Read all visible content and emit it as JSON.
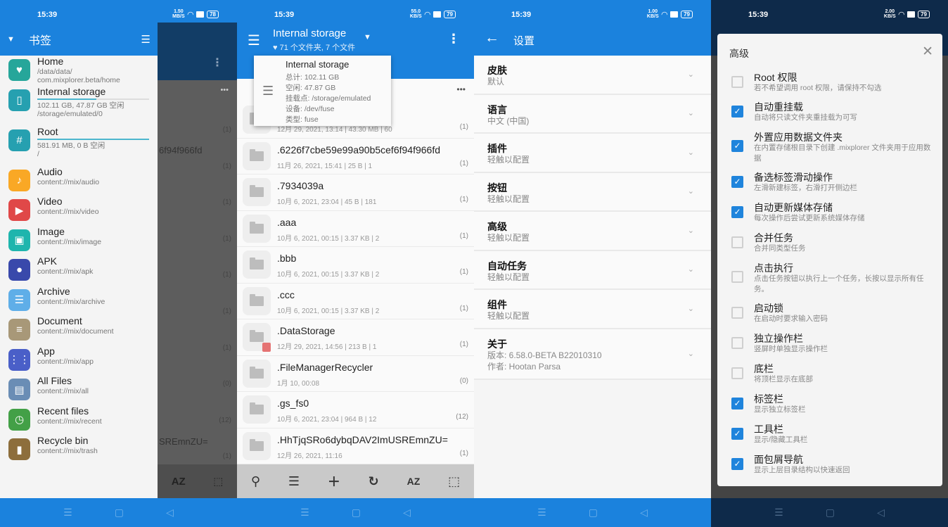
{
  "status_bars": [
    {
      "time": "15:39",
      "net_speed": "1.50",
      "net_unit": "MB/S",
      "battery": "78"
    },
    {
      "time": "15:39",
      "net_speed": "55.0",
      "net_unit": "KB/S",
      "battery": "79"
    },
    {
      "time": "15:39",
      "net_speed": "1.00",
      "net_unit": "KB/S",
      "battery": "79"
    },
    {
      "time": "15:39",
      "net_speed": "2.00",
      "net_unit": "KB/S",
      "battery": "79"
    }
  ],
  "colors": {
    "primary": "#1b82dd",
    "checkbox": "#1f84dc"
  },
  "drawer": {
    "title": "书签",
    "items": [
      {
        "name": "Home",
        "sub": "/data/data/",
        "sub2": "com.mixplorer.beta/home",
        "icon": "heart-icon",
        "color": "#26a69a"
      },
      {
        "name": "Internal storage",
        "sub": "102.11 GB, 47.87 GB 空闲",
        "sub2": "/storage/emulated/0",
        "icon": "phone-icon",
        "color": "#26a0b0",
        "usage": 0.53
      },
      {
        "name": "Root",
        "sub": "581.91 MB, 0 B 空闲",
        "sub2": "/",
        "icon": "hash-icon",
        "color": "#26a0b0",
        "usage": 1.0
      },
      {
        "name": "Audio",
        "sub": "content://mix/audio",
        "icon": "music-icon",
        "color": "#f9a825"
      },
      {
        "name": "Video",
        "sub": "content://mix/video",
        "icon": "play-icon",
        "color": "#e04848"
      },
      {
        "name": "Image",
        "sub": "content://mix/image",
        "icon": "image-icon",
        "color": "#1eb5ad"
      },
      {
        "name": "APK",
        "sub": "content://mix/apk",
        "icon": "android-icon",
        "color": "#3949ab"
      },
      {
        "name": "Archive",
        "sub": "content://mix/archive",
        "icon": "archive-icon",
        "color": "#5faee8"
      },
      {
        "name": "Document",
        "sub": "content://mix/document",
        "icon": "document-icon",
        "color": "#a89878"
      },
      {
        "name": "App",
        "sub": "content://mix/app",
        "icon": "grid-icon",
        "color": "#4a5fc8"
      },
      {
        "name": "All Files",
        "sub": "content://mix/all",
        "icon": "file-icon",
        "color": "#6a8db5"
      },
      {
        "name": "Recent files",
        "sub": "content://mix/recent",
        "icon": "clock-icon",
        "color": "#43a047"
      },
      {
        "name": "Recycle bin",
        "sub": "content://mix/trash",
        "icon": "trash-icon",
        "color": "#8d6e3c"
      }
    ],
    "behind_text": [
      "6f94f966fd",
      "SREmnZU="
    ],
    "behind_counts": [
      "(1)",
      "(1)",
      "(1)",
      "(1)",
      "(1)",
      "(1)",
      "(1)",
      "(0)",
      "(12)",
      "(1)"
    ],
    "toolbar_az": "AZ"
  },
  "browser": {
    "title": "Internal storage",
    "subtitle": "71 个文件夹, 7 个文件",
    "popup": {
      "title": "Internal storage",
      "lines": [
        "总计: 102.11 GB",
        "空闲: 47.87 GB",
        "挂载点: /storage/emulated",
        "设备: /dev/fuse",
        "类型: fuse"
      ]
    },
    "files": [
      {
        "name": "",
        "meta": "12月 29, 2021, 13:14 | 43.30 MB | 60",
        "count": "(1)"
      },
      {
        "name": ".6226f7cbe59e99a90b5cef6f94f966fd",
        "meta": "11月 26, 2021, 15:41 | 25 B | 1",
        "count": "(1)"
      },
      {
        "name": ".7934039a",
        "meta": "10月 6, 2021, 23:04 | 45 B | 181",
        "count": "(1)"
      },
      {
        "name": ".aaa",
        "meta": "10月 6, 2021, 00:15 | 3.37  KB | 2",
        "count": "(1)"
      },
      {
        "name": ".bbb",
        "meta": "10月 6, 2021, 00:15 | 3.37  KB | 2",
        "count": "(1)"
      },
      {
        "name": ".ccc",
        "meta": "10月 6, 2021, 00:15 | 3.37  KB | 2",
        "count": "(1)"
      },
      {
        "name": ".DataStorage",
        "meta": "12月 29, 2021, 14:56 | 213 B | 1",
        "count": "(1)",
        "badge": true
      },
      {
        "name": ".FileManagerRecycler",
        "meta": "1月 10, 00:08",
        "count": "(0)"
      },
      {
        "name": ".gs_fs0",
        "meta": "10月 6, 2021, 23:04 | 964 B | 12",
        "count": "(12)"
      },
      {
        "name": ".HhTjqSRo6dybqDAV2ImUSREmnZU=",
        "meta": "12月 26, 2021, 11:16",
        "count": "(1)"
      }
    ],
    "toolbar": {
      "az": "AZ"
    }
  },
  "settings": {
    "title": "设置",
    "items": [
      {
        "title": "皮肤",
        "sub": "默认"
      },
      {
        "title": "语言",
        "sub": "中文 (中国)"
      },
      {
        "title": "插件",
        "sub": "轻触以配置"
      },
      {
        "title": "按钮",
        "sub": "轻触以配置"
      },
      {
        "title": "高级",
        "sub": "轻触以配置"
      },
      {
        "title": "自动任务",
        "sub": "轻触以配置"
      },
      {
        "title": "组件",
        "sub": "轻触以配置"
      },
      {
        "title": "关于",
        "sub": "版本: 6.58.0-BETA  B22010310",
        "sub2": "作者: Hootan Parsa"
      }
    ]
  },
  "advanced": {
    "title": "高级",
    "options": [
      {
        "title": "Root 权限",
        "sub": "若不希望调用 root 权限，请保持不勾选",
        "checked": false
      },
      {
        "title": "自动重挂载",
        "sub": "自动将只读文件夹重挂载为可写",
        "checked": true
      },
      {
        "title": "外置应用数据文件夹",
        "sub": "在内置存储根目录下创建 .mixplorer 文件夹用于应用数据",
        "checked": true
      },
      {
        "title": "备选标签滑动操作",
        "sub": "左滑新建标签，右滑打开侧边栏",
        "checked": true
      },
      {
        "title": "自动更新媒体存储",
        "sub": "每次操作后尝试更新系统媒体存储",
        "checked": true
      },
      {
        "title": "合并任务",
        "sub": "合并同类型任务",
        "checked": false
      },
      {
        "title": "点击执行",
        "sub": "点击任务按钮以执行上一个任务，长按以显示所有任务。",
        "checked": false
      },
      {
        "title": "启动锁",
        "sub": "在启动时要求输入密码",
        "checked": false
      },
      {
        "title": "独立操作栏",
        "sub": "竖屏时单独显示操作栏",
        "checked": false
      },
      {
        "title": "底栏",
        "sub": "将顶栏显示在底部",
        "checked": false
      },
      {
        "title": "标签栏",
        "sub": "显示独立标签栏",
        "checked": true
      },
      {
        "title": "工具栏",
        "sub": "显示/隐藏工具栏",
        "checked": true
      },
      {
        "title": "面包屑导航",
        "sub": "显示上层目录结构以快速返回",
        "checked": true
      }
    ]
  }
}
